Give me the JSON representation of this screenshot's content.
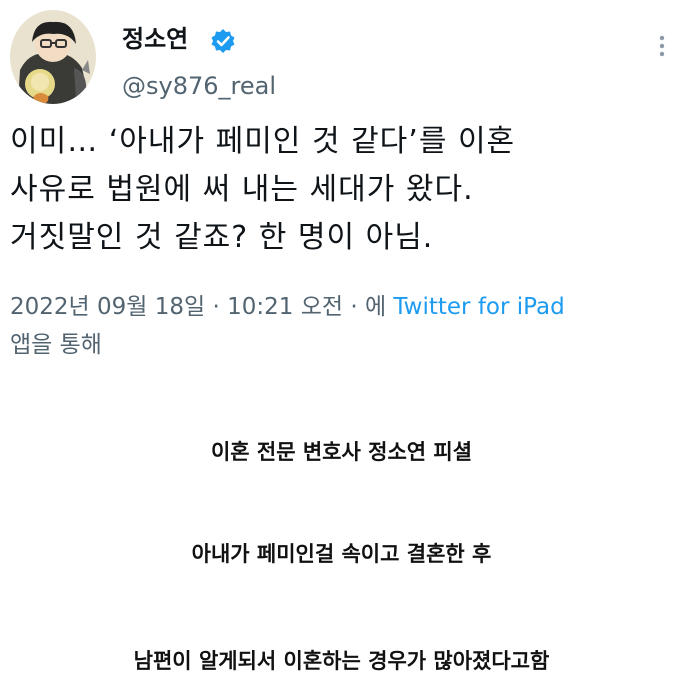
{
  "tweet": {
    "display_name": "정소연",
    "handle": "@sy876_real",
    "verified_icon": "verified-badge-icon",
    "more_icon": "vertical-ellipsis-icon",
    "text_lines": [
      "이미… ‘아내가 페미인 것 같다’를 이혼",
      "사유로 법원에 써 내는 세대가 왔다.",
      "거짓말인 것 같죠? 한 명이 아님."
    ],
    "timestamp": "2022년 09월 18일 · 10:21 오전 · 에",
    "source": "Twitter for iPad",
    "source_suffix": "앱을 통해",
    "colors": {
      "text": "#0f1419",
      "secondary": "#536471",
      "link": "#1d9bf0"
    }
  },
  "captions": [
    "이혼 전문 변호사 정소연 피셜",
    "아내가 페미인걸 속이고 결혼한 후",
    "남편이 알게되서 이혼하는 경우가 많아졌다고함"
  ]
}
